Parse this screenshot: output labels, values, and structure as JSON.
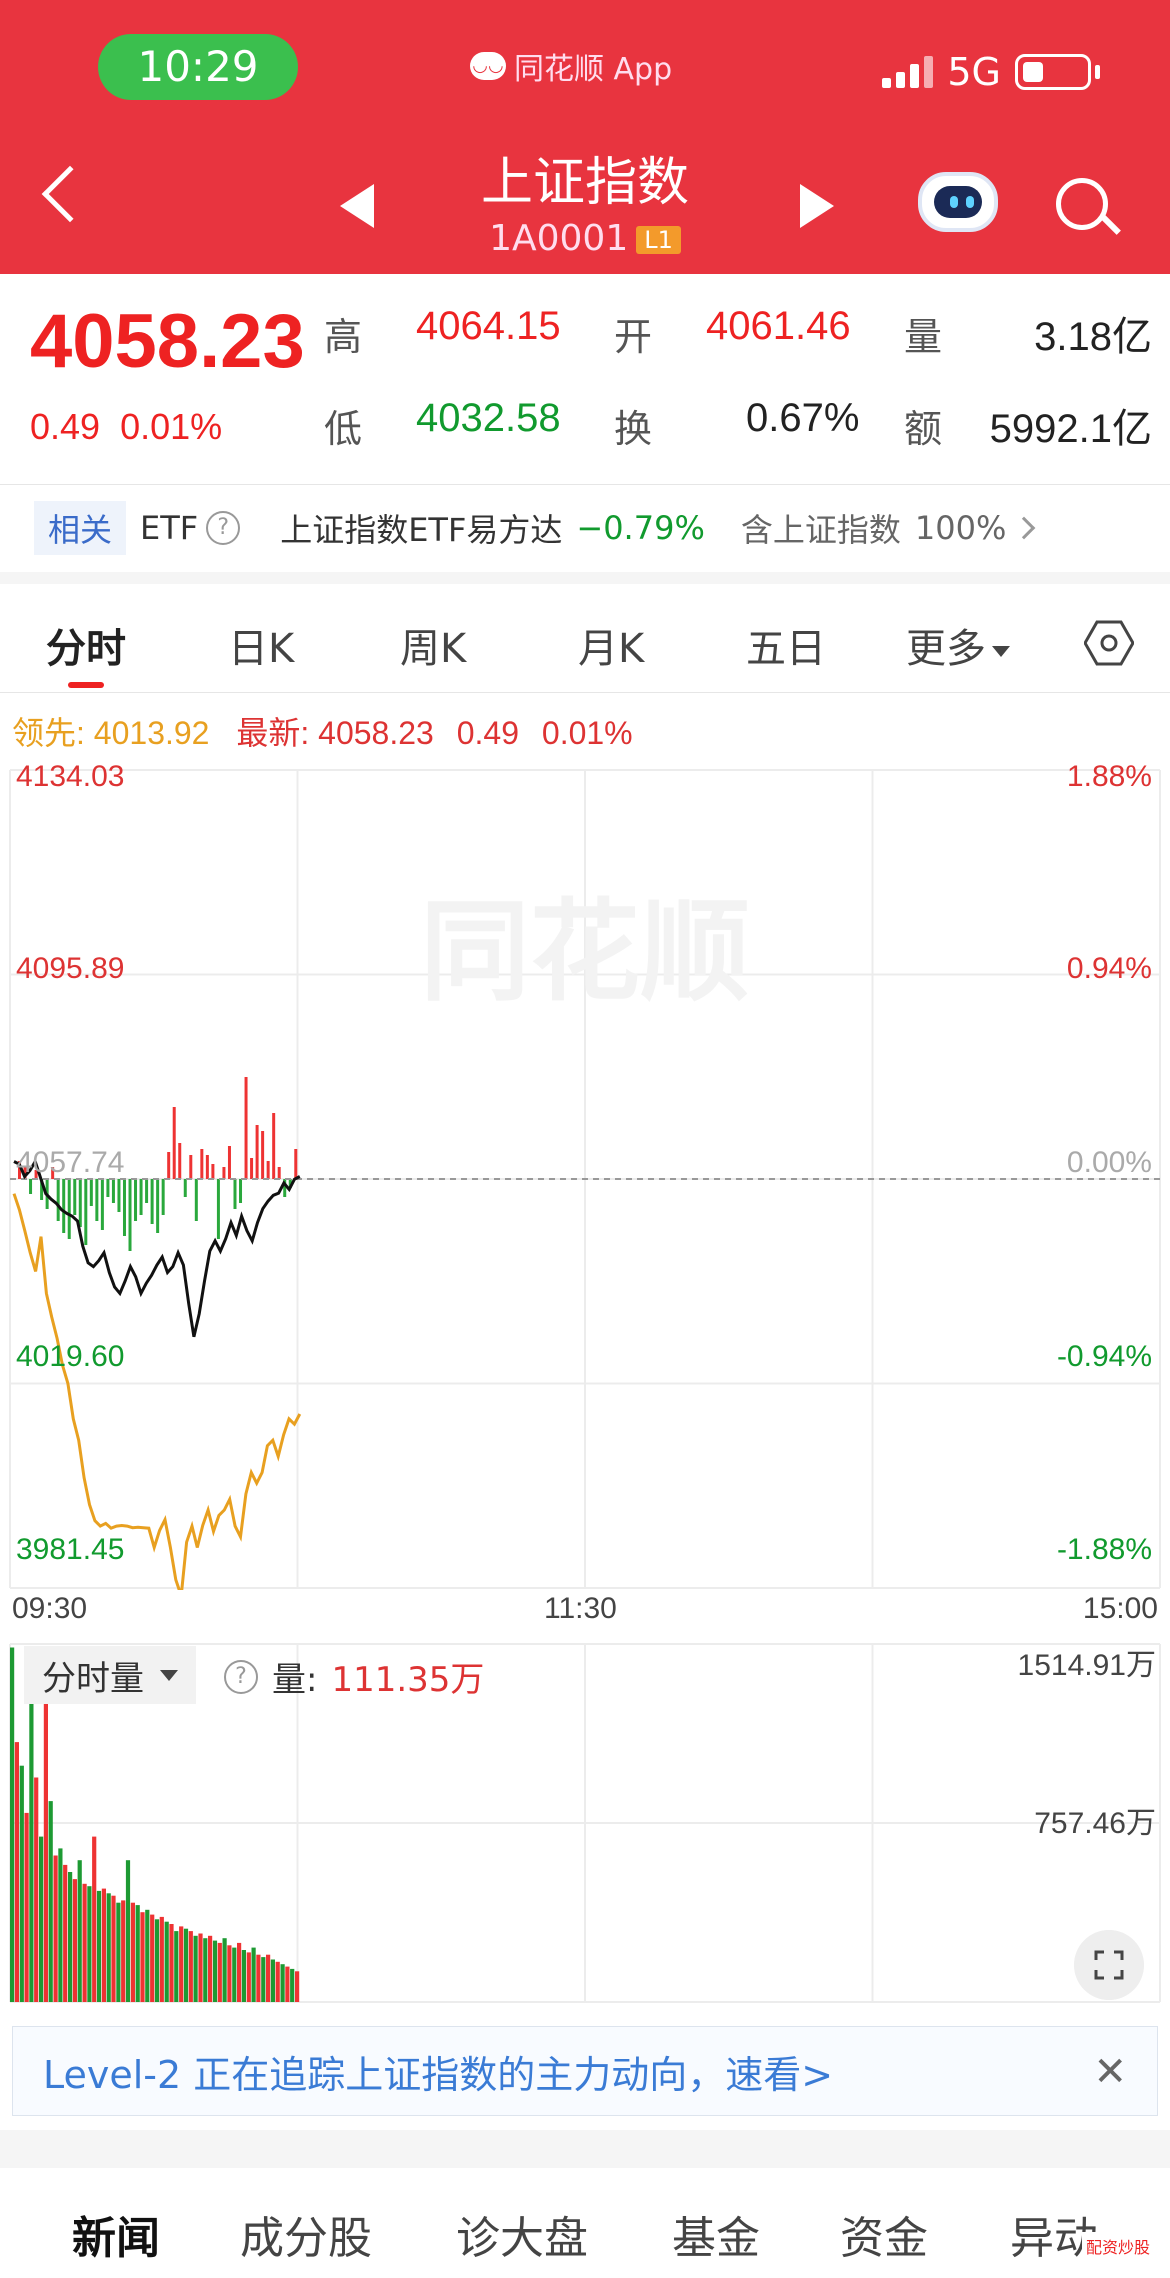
{
  "status_bar": {
    "time": "10:29",
    "app_name": "同花顺 App",
    "network": "5G"
  },
  "header": {
    "title": "上证指数",
    "code": "1A0001",
    "level_badge": "L1"
  },
  "quote": {
    "price": "4058.23",
    "change_abs": "0.49",
    "change_pct": "0.01%",
    "fields": {
      "high_label": "高",
      "high": "4064.15",
      "open_label": "开",
      "open": "4061.46",
      "volume_label": "量",
      "volume": "3.18亿",
      "low_label": "低",
      "low": "4032.58",
      "turnover_label": "换",
      "turnover": "0.67%",
      "amount_label": "额",
      "amount": "5992.1亿"
    }
  },
  "etf": {
    "related_label": "相关",
    "etf_label": "ETF",
    "name": "上证指数ETF易方达",
    "pct": "−0.79%",
    "contain_label": "含上证指数",
    "weight": "100%"
  },
  "tabs": [
    {
      "label": "分时",
      "active": true
    },
    {
      "label": "日K"
    },
    {
      "label": "周K"
    },
    {
      "label": "月K"
    },
    {
      "label": "五日"
    },
    {
      "label": "更多"
    }
  ],
  "chart_info": {
    "lead_label": "领先:",
    "lead_value": "4013.92",
    "latest_label": "最新:",
    "latest_value": "4058.23",
    "latest_change": "0.49",
    "latest_pct": "0.01%"
  },
  "chart_data": {
    "type": "line",
    "y_left_ticks": [
      "4134.03",
      "4095.89",
      "4057.74",
      "4019.60",
      "3981.45"
    ],
    "y_right_ticks": [
      "1.88%",
      "0.94%",
      "0.00%",
      "-0.94%",
      "-1.88%"
    ],
    "x_ticks": [
      "09:30",
      "11:30",
      "15:00"
    ],
    "ylim": [
      3981.45,
      4134.03
    ],
    "reference": 4057.74,
    "series": [
      {
        "values": [
          4061.0,
          4060.5,
          4058.2,
          4059.3,
          4061.0,
          4058.0,
          4055.0,
          4054.0,
          4053.2,
          4052.0,
          4051.3,
          4050.8,
          4049.9,
          4045.2,
          4042.1,
          4041.4,
          4042.5,
          4044.0,
          4040.3,
          4037.6,
          4036.4,
          4038.7,
          4041.4,
          4039.5,
          4036.4,
          4038.3,
          4039.8,
          4041.7,
          4043.2,
          4040.3,
          4041.4,
          4044.0,
          4041.7,
          4034.5,
          4028.3,
          4032.6,
          4038.7,
          4044.3,
          4046.2,
          4044.3,
          4046.6,
          4049.6,
          4047.2,
          4050.8,
          4048.1,
          4046.2,
          4049.6,
          4052.2,
          4053.6,
          4054.7,
          4055.1,
          4057.0,
          4055.8,
          4057.7,
          4058.2
        ],
        "color": "#111111"
      },
      {
        "values": [
          4055.0,
          4052.0,
          4048.1,
          4044.0,
          4040.5,
          4047.0,
          4036.4,
          4032.0,
          4028.0,
          4023.0,
          4019.6,
          4013.0,
          4009.0,
          4002.0,
          3997.0,
          3994.0,
          3993.0,
          3993.5,
          3992.6,
          3993.0,
          3993.1,
          3993.0,
          3992.7,
          3992.8,
          3992.7,
          3992.6,
          3989.0,
          3992.2,
          3994.2,
          3989.0,
          3983.0,
          3980.0,
          3990.0,
          3993.0,
          3989.0,
          3993.1,
          3996.0,
          3992.0,
          3995.0,
          3996.0,
          3998.0,
          3993.0,
          3991.0,
          3999.0,
          4003.0,
          4001.0,
          4003.0,
          4008.0,
          4009.0,
          4006.0,
          4010.0,
          4013.0,
          4012.0,
          4013.9
        ],
        "color": "#e8a020"
      }
    ],
    "flow_bars": [
      6,
      4,
      -5,
      3,
      -7,
      -10,
      4,
      -14,
      -18,
      -20,
      -12,
      -16,
      -22,
      -9,
      -14,
      -17,
      -6,
      -8,
      -11,
      -19,
      -24,
      -14,
      -12,
      -8,
      -15,
      -18,
      -12,
      9,
      24,
      12,
      -6,
      8,
      -14,
      10,
      8,
      5,
      -20,
      4,
      11,
      -10,
      -8,
      34,
      7,
      18,
      16,
      6,
      22,
      4,
      -6,
      -3,
      10
    ],
    "volume": {
      "ylim": [
        0,
        1514.91
      ],
      "ticks": [
        "1514.91万",
        "757.46万"
      ],
      "values": [
        1500,
        1100,
        1000,
        800,
        1500,
        950,
        700,
        1350,
        850,
        620,
        650,
        580,
        550,
        520,
        600,
        500,
        490,
        700,
        470,
        480,
        460,
        450,
        420,
        430,
        600,
        420,
        410,
        380,
        390,
        370,
        350,
        360,
        340,
        330,
        300,
        320,
        310,
        300,
        280,
        290,
        270,
        280,
        260,
        250,
        270,
        240,
        230,
        250,
        220,
        210,
        230,
        200,
        190,
        200,
        180,
        170,
        160,
        150,
        140,
        130
      ]
    }
  },
  "volume_panel": {
    "selector_label": "分时量",
    "vol_label": "量:",
    "vol_value": "111.35万"
  },
  "banner": {
    "text": "Level-2 正在追踪上证指数的主力动向，速看>"
  },
  "bottom_tabs": [
    "新闻",
    "成分股",
    "诊大盘",
    "基金",
    "资金",
    "异动"
  ],
  "watermark": "同花顺",
  "corner_badge": "配资炒股"
}
